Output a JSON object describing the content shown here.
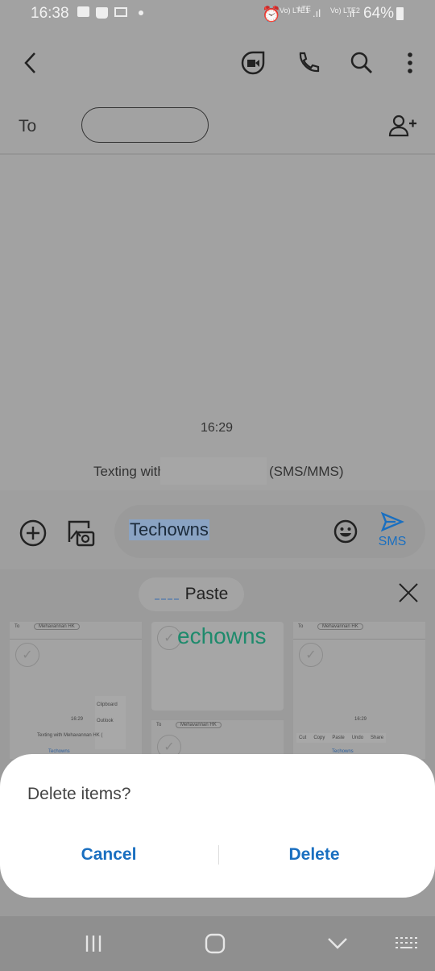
{
  "status_bar": {
    "time": "16:38",
    "lte1": "Vo) LTE1",
    "lte": "LTE",
    "lte2": "Vo) LTE2",
    "battery": "64%"
  },
  "app_bar": {
    "icons": [
      "back-icon",
      "video-call-icon",
      "phone-icon",
      "search-icon",
      "more-icon"
    ]
  },
  "to_bar": {
    "label": "To",
    "recipient": ""
  },
  "conversation": {
    "timestamp": "16:29",
    "info_prefix": "Texting with",
    "info_suffix": "(SMS/MMS)"
  },
  "composer": {
    "text": "Techowns",
    "send_label": "SMS",
    "accent": "#1a6fc0"
  },
  "clipboard": {
    "paste_label": "Paste",
    "items": [
      {
        "to": "To",
        "recipient": "Mehavannan HK",
        "time": "16:29",
        "info": "Texting with Mehavannan HK (",
        "menu": [
          "Clipboard",
          "Outlook"
        ],
        "text": "Techowns"
      },
      {
        "text": "echowns",
        "to": "To",
        "recipient": "Mehavannan HK"
      },
      {
        "to": "To",
        "recipient": "Mehavannan HK",
        "time": "16:29",
        "menu": [
          "Cut",
          "Copy",
          "Paste",
          "Undo",
          "Share"
        ],
        "text": "Techowns"
      }
    ],
    "text_color": "#1e8a6c"
  },
  "dialog": {
    "title": "Delete items?",
    "cancel": "Cancel",
    "delete": "Delete"
  },
  "nav_bar": {
    "icons": [
      "recents-icon",
      "home-icon",
      "hide-keyboard-icon",
      "keyboard-icon"
    ]
  }
}
